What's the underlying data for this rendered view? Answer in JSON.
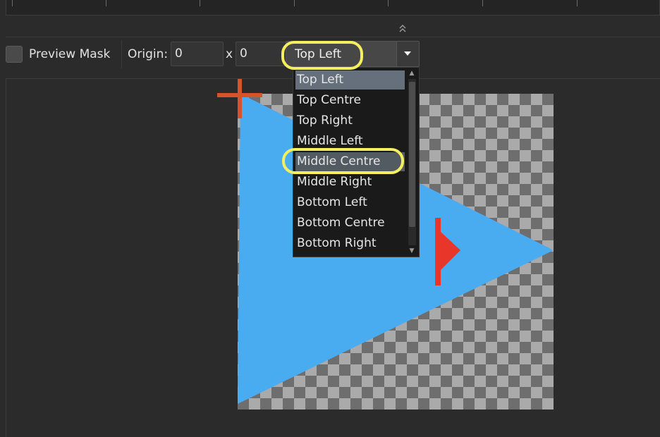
{
  "toolbar": {
    "preview_mask_label": "Preview Mask",
    "origin_label": "Origin:",
    "origin_x": "0",
    "separator": "x",
    "origin_y": "0",
    "anchor_selected": "Top Left"
  },
  "dropdown": {
    "items": [
      {
        "label": "Top Left"
      },
      {
        "label": "Top Centre"
      },
      {
        "label": "Top Right"
      },
      {
        "label": "Middle Left"
      },
      {
        "label": "Middle Centre"
      },
      {
        "label": "Middle Right"
      },
      {
        "label": "Bottom Left"
      },
      {
        "label": "Bottom Centre"
      },
      {
        "label": "Bottom Right"
      }
    ],
    "selected_index": 0,
    "hover_index": 4
  },
  "colors": {
    "shape_fill": "#4aacf0",
    "marker_red": "#e8362b",
    "origin_cross": "#d5542a",
    "highlight": "#f4ef5f"
  },
  "icons": {
    "collapse": "double-chevron-up-icon",
    "combo_arrow": "triangle-down-icon",
    "scroll_up": "triangle-up-icon",
    "scroll_down": "triangle-down-icon"
  }
}
